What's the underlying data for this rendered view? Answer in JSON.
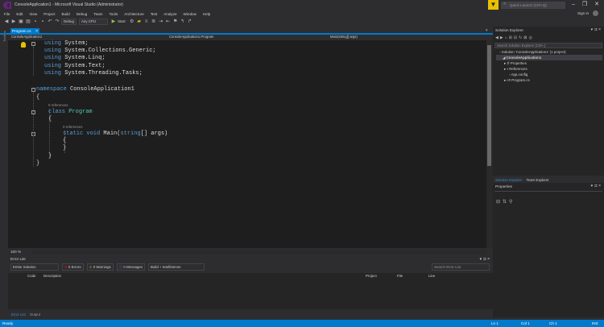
{
  "window": {
    "title": "ConsoleApplication1 - Microsoft Visual Studio (Administrator)",
    "quick_launch": "Quick Launch (Ctrl+Q)",
    "sign_in": "Sign in"
  },
  "menu": [
    "File",
    "Edit",
    "View",
    "Project",
    "Build",
    "Debug",
    "Team",
    "Tools",
    "Architecture",
    "Test",
    "Analyze",
    "Window",
    "Help"
  ],
  "toolbar": {
    "config": "Debug",
    "platform": "Any CPU",
    "start": "Start"
  },
  "left_strip": "Toolbox",
  "tabs": {
    "active": "Program.cs",
    "close": "×"
  },
  "navbar": {
    "project": "ConsoleApplication1",
    "class": "ConsoleApplication1.Program",
    "member": "Main(string[] args)"
  },
  "code": [
    {
      "kw": "using",
      "rest": " System;"
    },
    {
      "kw": "using",
      "rest": " System.Collections.Generic;"
    },
    {
      "kw": "using",
      "rest": " System.Linq;"
    },
    {
      "kw": "using",
      "rest": " System.Text;"
    },
    {
      "kw": "using",
      "rest": " System.Threading.Tasks;"
    },
    {
      "kw": "namespace",
      "rest": " ConsoleApplication1"
    },
    {
      "text": "{"
    },
    {
      "ref": "0 references"
    },
    {
      "kw": "class",
      "type": " Program"
    },
    {
      "text": "{"
    },
    {
      "ref": "0 references"
    },
    {
      "kw": "static void",
      "rest": " Main(",
      "kw2": "string",
      "rest2": "[] args)"
    },
    {
      "text": "{"
    },
    {
      "text": "}"
    },
    {
      "text": "}"
    },
    {
      "text": "}"
    }
  ],
  "editor": {
    "zoom": "100 %"
  },
  "error_list": {
    "title": "Error List",
    "scope": "Entire Solution",
    "errors": "0 Errors",
    "warnings": "0 Warnings",
    "messages": "0 Messages",
    "build_filter": "Build + IntelliSense",
    "search": "Search Error List",
    "columns": [
      "Code",
      "Description",
      "Project",
      "File",
      "Line"
    ],
    "bottom_tabs": [
      "Error List",
      "Output"
    ]
  },
  "solution_explorer": {
    "title": "Solution Explorer",
    "search": "Search Solution Explorer (Ctrl+;)",
    "solution": "Solution 'ConsoleApplication1' (1 project)",
    "project": "ConsoleApplication1",
    "items": [
      "Properties",
      "References",
      "App.config",
      "Program.cs"
    ],
    "tabs": [
      "Solution Explorer",
      "Team Explorer"
    ]
  },
  "properties": {
    "title": "Properties"
  },
  "status": {
    "left": "Ready",
    "ln": "Ln 1",
    "col": "Col 1",
    "ch": "Ch 1",
    "mode": "INS"
  },
  "colors": {
    "accent": "#007acc",
    "keyword": "#569cd6",
    "type": "#4ec9b0",
    "editor_bg": "#1e1e1e",
    "chrome": "#2d2d30"
  }
}
